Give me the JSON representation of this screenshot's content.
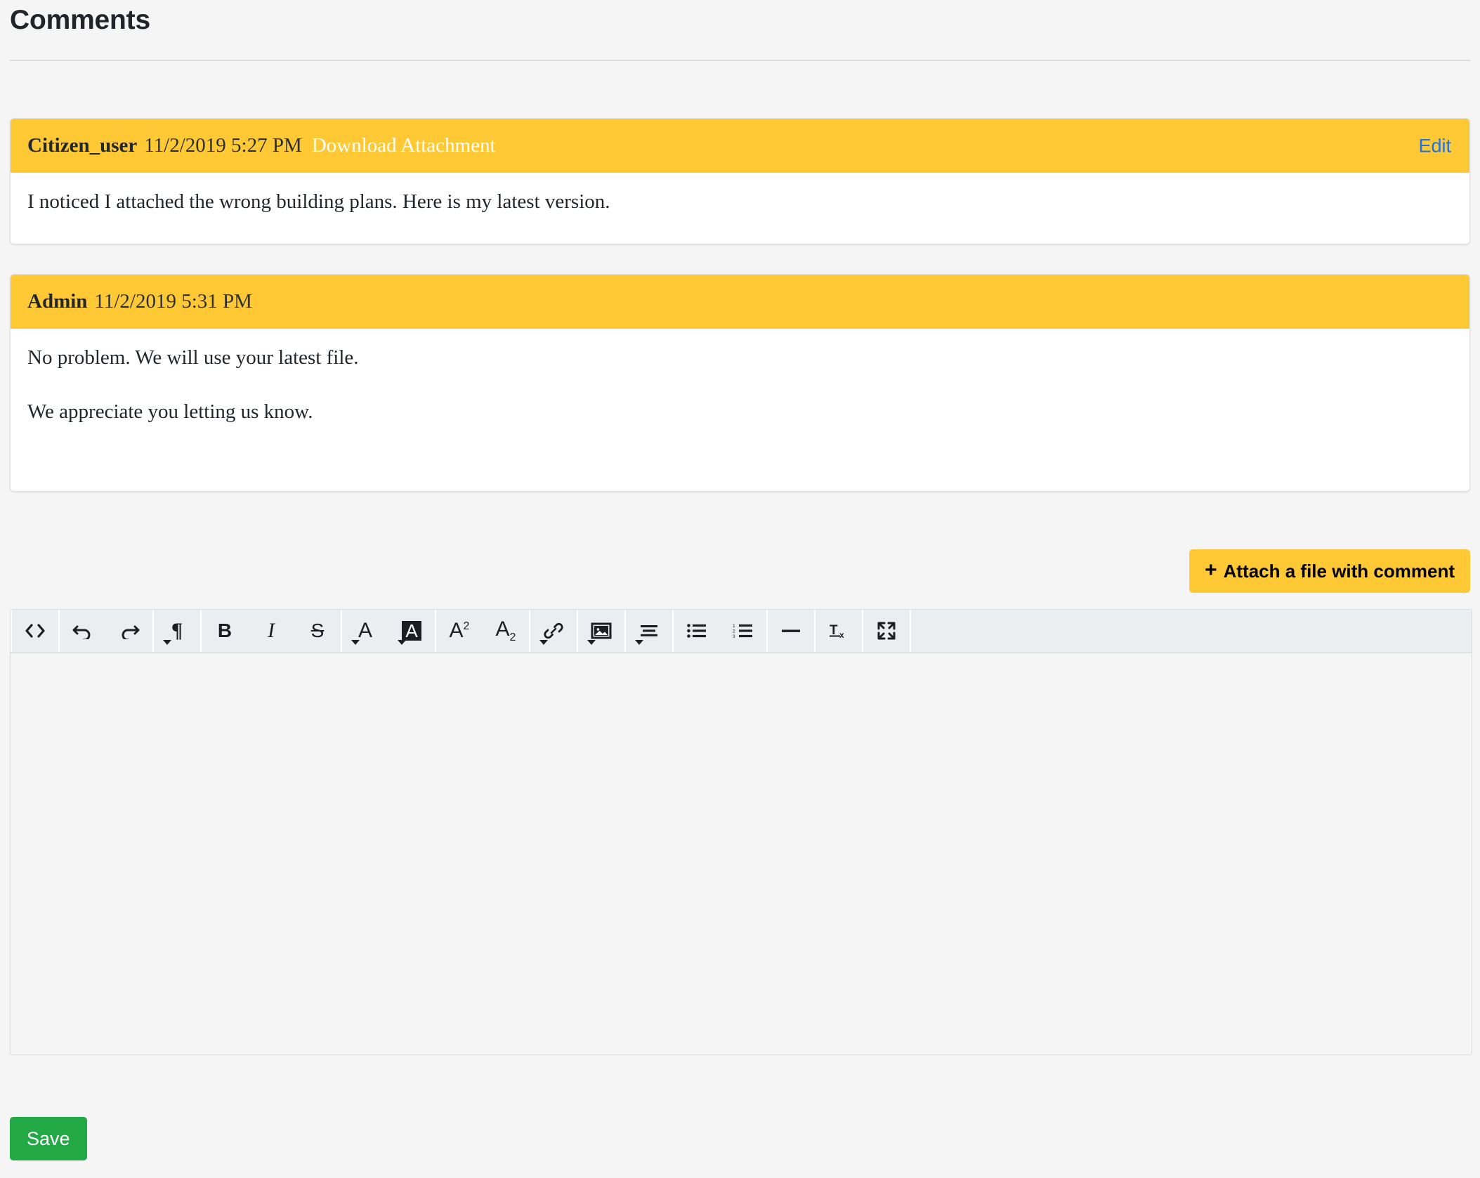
{
  "page": {
    "title": "Comments"
  },
  "comments": [
    {
      "author": "Citizen_user",
      "timestamp": "11/2/2019 5:27 PM",
      "attachment_label": "Download Attachment",
      "edit_label": "Edit",
      "paragraphs": [
        "I noticed I attached the wrong building plans. Here is my latest version."
      ]
    },
    {
      "author": "Admin",
      "timestamp": "11/2/2019 5:31 PM",
      "paragraphs": [
        "No problem. We will use your latest file.",
        "We appreciate you letting us know."
      ]
    }
  ],
  "attach_button": {
    "icon": "plus-icon",
    "plus": "+",
    "label": "Attach a file with comment"
  },
  "editor": {
    "content": "",
    "placeholder": "",
    "toolbar_groups": [
      {
        "name": "source",
        "buttons": [
          {
            "name": "code-view-icon",
            "title": "Code View",
            "glyph": "<>",
            "dropdown": false
          }
        ]
      },
      {
        "name": "history",
        "buttons": [
          {
            "name": "undo-icon",
            "title": "Undo",
            "glyph": "↩",
            "dropdown": false
          },
          {
            "name": "redo-icon",
            "title": "Redo",
            "glyph": "↪",
            "dropdown": false
          }
        ]
      },
      {
        "name": "paragraph-format",
        "buttons": [
          {
            "name": "paragraph-format-icon",
            "title": "Paragraph Format",
            "glyph": "¶",
            "dropdown": true
          }
        ]
      },
      {
        "name": "text-style",
        "buttons": [
          {
            "name": "bold-icon",
            "title": "Bold",
            "glyph": "B",
            "dropdown": false
          },
          {
            "name": "italic-icon",
            "title": "Italic",
            "glyph": "I",
            "dropdown": false
          },
          {
            "name": "strikethrough-icon",
            "title": "Strikethrough",
            "glyph": "S",
            "dropdown": false
          }
        ]
      },
      {
        "name": "colors",
        "buttons": [
          {
            "name": "text-color-icon",
            "title": "Text Color",
            "glyph": "A",
            "dropdown": true
          },
          {
            "name": "background-color-icon",
            "title": "Background Color",
            "glyph": "A",
            "dropdown": true
          }
        ]
      },
      {
        "name": "script",
        "buttons": [
          {
            "name": "superscript-icon",
            "title": "Superscript",
            "glyph": "A2",
            "dropdown": false
          },
          {
            "name": "subscript-icon",
            "title": "Subscript",
            "glyph": "A2",
            "dropdown": false
          }
        ]
      },
      {
        "name": "insert-link",
        "buttons": [
          {
            "name": "link-icon",
            "title": "Insert Link",
            "glyph": "🔗",
            "dropdown": true
          }
        ]
      },
      {
        "name": "insert-image",
        "buttons": [
          {
            "name": "image-icon",
            "title": "Insert Image",
            "glyph": "🖼",
            "dropdown": true
          }
        ]
      },
      {
        "name": "align",
        "buttons": [
          {
            "name": "align-icon",
            "title": "Align",
            "glyph": "≡",
            "dropdown": true
          }
        ]
      },
      {
        "name": "lists",
        "buttons": [
          {
            "name": "unordered-list-icon",
            "title": "Unordered List",
            "glyph": "☰",
            "dropdown": false
          },
          {
            "name": "ordered-list-icon",
            "title": "Ordered List",
            "glyph": "☰",
            "dropdown": false
          }
        ]
      },
      {
        "name": "rule",
        "buttons": [
          {
            "name": "horizontal-rule-icon",
            "title": "Insert Horizontal Line",
            "glyph": "—",
            "dropdown": false
          }
        ]
      },
      {
        "name": "clear",
        "buttons": [
          {
            "name": "clear-formatting-icon",
            "title": "Clear Formatting",
            "glyph": "Tx",
            "dropdown": false
          }
        ]
      },
      {
        "name": "fullscreen",
        "buttons": [
          {
            "name": "fullscreen-icon",
            "title": "Fullscreen",
            "glyph": "⛶",
            "dropdown": false
          }
        ]
      }
    ]
  },
  "save_button": {
    "label": "Save"
  },
  "colors": {
    "accent_yellow": "#ffc835",
    "link_blue": "#1a73e8",
    "save_green": "#22a844",
    "page_background": "#f5f5f6",
    "toolbar_background": "#eaeef0",
    "attachment_link": "#ffffff"
  }
}
